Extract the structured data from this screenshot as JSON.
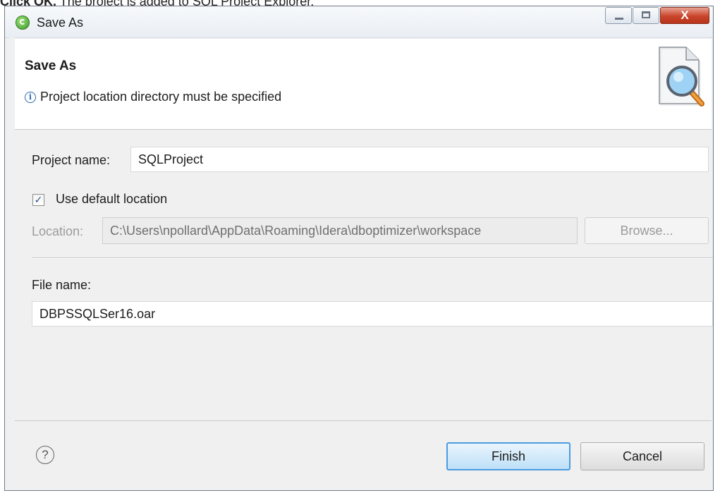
{
  "caption": {
    "bold": "Click OK.",
    "text": " The project is added to SQL Project Explorer."
  },
  "window": {
    "title": "Save As",
    "close_glyph": "X"
  },
  "banner": {
    "title": "Save As",
    "info_glyph": "i",
    "message": "Project location directory must be specified",
    "image_icon": "document-search-icon"
  },
  "form": {
    "project_name_label": "Project name:",
    "project_name_value": "SQLProject",
    "use_default_label": "Use default location",
    "use_default_checked": true,
    "location_label": "Location:",
    "location_value": "C:\\Users\\npollard\\AppData\\Roaming\\Idera\\dboptimizer\\workspace",
    "browse_label": "Browse...",
    "file_name_label": "File name:",
    "file_name_value": "DBPSSQLSer16.oar"
  },
  "footer": {
    "help_glyph": "?",
    "finish_label": "Finish",
    "cancel_label": "Cancel"
  },
  "colors": {
    "title_bar": "#e9eef4",
    "close_button": "#c9442b",
    "default_button_border": "#4b9be0",
    "info_icon": "#2c69b3",
    "dialog_background": "#f0f0f0"
  }
}
